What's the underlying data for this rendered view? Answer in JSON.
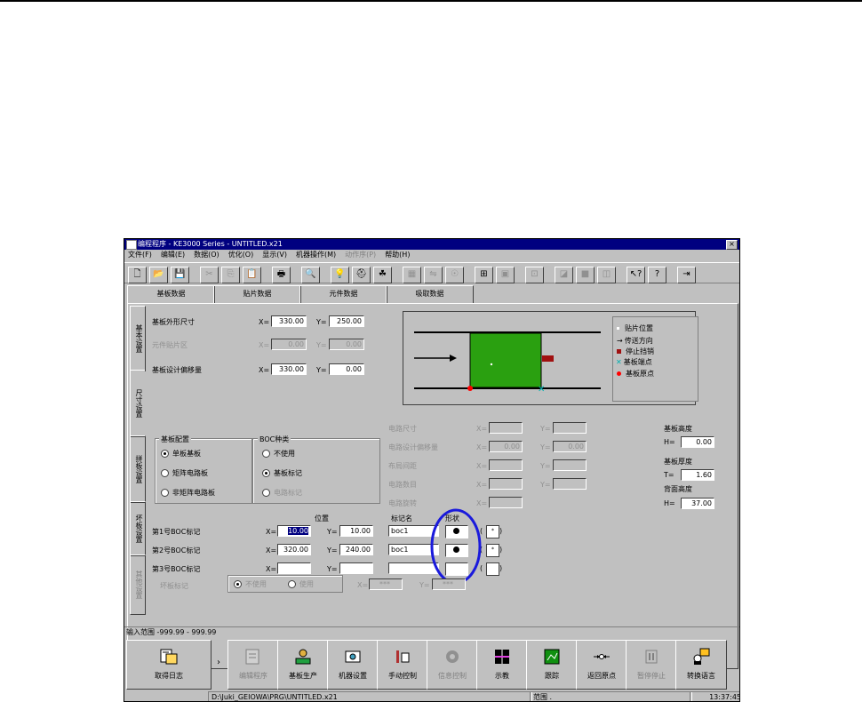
{
  "window": {
    "title": "编程程序 - KE3000 Series - UNTITLED.x21",
    "close_glyph": "×"
  },
  "menu": [
    {
      "label": "文件(F)",
      "disabled": false
    },
    {
      "label": "编辑(E)",
      "disabled": false
    },
    {
      "label": "数据(O)",
      "disabled": false
    },
    {
      "label": "优化(O)",
      "disabled": false
    },
    {
      "label": "显示(V)",
      "disabled": false
    },
    {
      "label": "机器操作(M)",
      "disabled": false
    },
    {
      "label": "动作序(P)",
      "disabled": true
    },
    {
      "label": "帮助(H)",
      "disabled": false
    }
  ],
  "tabs": [
    "基板数据",
    "贴片数据",
    "元件数据",
    "吸取数据"
  ],
  "side_tabs": [
    "基本设置",
    "尺寸设置",
    "拼板设置",
    "坏板设置",
    "其他设置"
  ],
  "board": {
    "outline_label": "基板外形尺寸",
    "outline_x": "330.00",
    "outline_y": "250.00",
    "area_label": "元件贴片区",
    "area_x": "0.00",
    "area_y": "0.00",
    "offset_label": "基板设计偏移量",
    "offset_x": "330.00",
    "offset_y": "0.00",
    "x_prefix": "X=",
    "y_prefix": "Y="
  },
  "legend": {
    "items": [
      "贴片位置",
      "传送方向",
      "停止挡销",
      "基板端点",
      "基板原点"
    ],
    "colors": {
      "board": "#2aa010",
      "stopper": "#a01010",
      "endpoint": "#00b0b0",
      "origin": "#ff0000"
    }
  },
  "layout_group": {
    "title": "基板配置",
    "options": [
      {
        "label": "单板基板",
        "selected": true,
        "disabled": false
      },
      {
        "label": "矩阵电路板",
        "selected": false,
        "disabled": false
      },
      {
        "label": "非矩阵电路板",
        "selected": false,
        "disabled": false
      }
    ]
  },
  "boc_group": {
    "title": "BOC种类",
    "options": [
      {
        "label": "不使用",
        "selected": false,
        "disabled": false
      },
      {
        "label": "基板标记",
        "selected": true,
        "disabled": false
      },
      {
        "label": "电路标记",
        "selected": false,
        "disabled": true
      }
    ]
  },
  "right_fields": {
    "labels": [
      "电路尺寸",
      "电路设计偏移量",
      "布局间距",
      "电路数目",
      "电路旋转"
    ],
    "values": [
      "",
      "0.00",
      "",
      "",
      ""
    ],
    "values2": [
      "",
      "0.00",
      "",
      "",
      ""
    ]
  },
  "heights": {
    "board_height_label": "基板高度",
    "board_height_prefix": "H=",
    "board_height": "0.00",
    "thickness_label": "基板厚度",
    "thickness_prefix": "T=",
    "thickness": "1.60",
    "back_height_label": "背面高度",
    "back_height_prefix": "H=",
    "back_height": "37.00"
  },
  "boc_table": {
    "col_position": "位置",
    "col_mark": "标记名",
    "col_shape": "形状",
    "rows": [
      {
        "label": "第1号BOC标记",
        "x": "10.00",
        "y": "10.00",
        "mark": "boc1",
        "shape": true,
        "option": "*"
      },
      {
        "label": "第2号BOC标记",
        "x": "320.00",
        "y": "240.00",
        "mark": "boc1",
        "shape": true,
        "option": "*"
      },
      {
        "label": "第3号BOC标记",
        "x": "",
        "y": "",
        "mark": "",
        "shape": false,
        "option": ""
      }
    ]
  },
  "bad_mark": {
    "label": "坏板标记",
    "opt1": "不使用",
    "opt2": "使用",
    "x": "***",
    "y": "***"
  },
  "status": {
    "input_range": "输入范围 -999.99 - 999.99"
  },
  "bottom_buttons": [
    {
      "label": "取得日志",
      "icon": "log-icon",
      "disabled": false
    },
    {
      "label": "编辑程序",
      "icon": "edit-program-icon",
      "disabled": true
    },
    {
      "label": "基板生产",
      "icon": "production-icon",
      "disabled": false
    },
    {
      "label": "机器设置",
      "icon": "machine-setup-icon",
      "disabled": false
    },
    {
      "label": "手动控制",
      "icon": "manual-control-icon",
      "disabled": false
    },
    {
      "label": "信息控制",
      "icon": "info-control-icon",
      "disabled": true
    },
    {
      "label": "示教",
      "icon": "teach-icon",
      "disabled": false
    },
    {
      "label": "跟踪",
      "icon": "tracking-icon",
      "disabled": false
    },
    {
      "label": "返回原点",
      "icon": "return-origin-icon",
      "disabled": false
    },
    {
      "label": "暂停停止",
      "icon": "pause-stop-icon",
      "disabled": true
    },
    {
      "label": "转换语言",
      "icon": "language-icon",
      "disabled": false
    }
  ],
  "footer": {
    "path": "D:\\Juki_GEIOWA\\PRG\\UNTITLED.x21",
    "range": "范围 .",
    "time": "13:37:45"
  }
}
